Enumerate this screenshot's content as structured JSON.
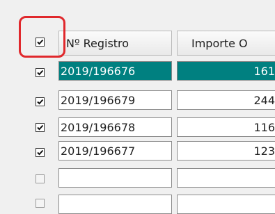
{
  "grid": {
    "header": {
      "select_all_checked": true,
      "col_registro": "Nº Registro",
      "col_importe": "Importe O"
    },
    "rows": [
      {
        "checked": true,
        "registro": "2019/196676",
        "importe": "161",
        "selected": true
      },
      {
        "checked": true,
        "registro": "2019/196679",
        "importe": "244",
        "selected": false
      },
      {
        "checked": true,
        "registro": "2019/196678",
        "importe": "116",
        "selected": false
      },
      {
        "checked": true,
        "registro": "2019/196677",
        "importe": "123",
        "selected": false
      },
      {
        "checked": false,
        "registro": "",
        "importe": "",
        "selected": false
      },
      {
        "checked": false,
        "registro": "",
        "importe": "",
        "selected": false
      }
    ]
  },
  "colors": {
    "selection": "#008080",
    "highlight": "#e0282c"
  }
}
